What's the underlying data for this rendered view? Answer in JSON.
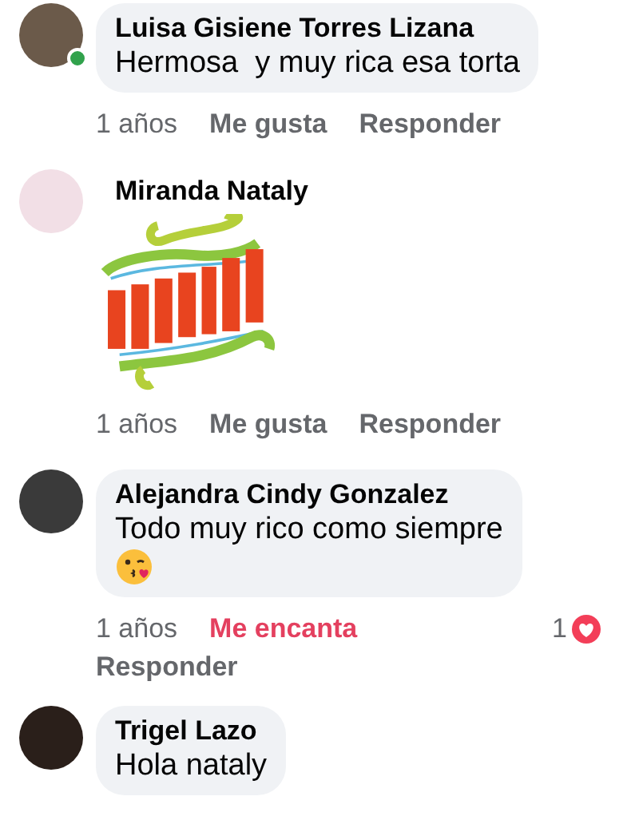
{
  "comments": [
    {
      "kind": "text",
      "author": "Luisa Gisiene Torres Lizana",
      "online": true,
      "text": "Hermosa  y muy rica esa torta",
      "time": "1 años",
      "like": {
        "label": "Me gusta",
        "reacted": false
      },
      "reply": "Responder"
    },
    {
      "kind": "sticker",
      "author": "Miranda Nataly",
      "online": false,
      "time": "1 años",
      "like": {
        "label": "Me gusta",
        "reacted": false
      },
      "reply": "Responder"
    },
    {
      "kind": "text",
      "author": "Alejandra Cindy Gonzalez",
      "online": false,
      "text": "Todo muy rico como siempre",
      "emoji": true,
      "time": "1 años",
      "like": {
        "label": "Me encanta",
        "reacted": true
      },
      "reply": "Responder",
      "reactions": {
        "count": "1",
        "kind": "love"
      }
    },
    {
      "kind": "text",
      "author": "Trigel Lazo",
      "online": false,
      "text": "Hola nataly"
    }
  ]
}
